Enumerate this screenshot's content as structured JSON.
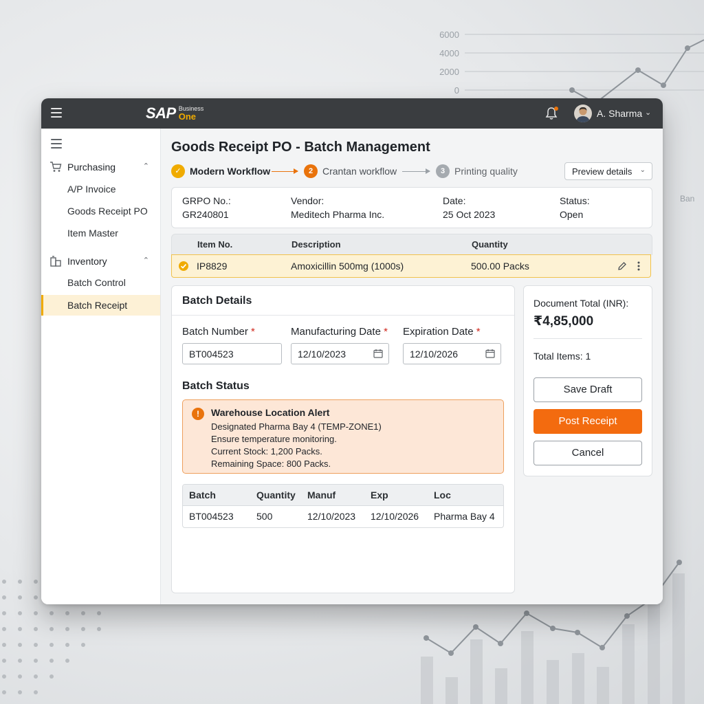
{
  "background": {
    "axis_ticks": [
      "6000",
      "4000",
      "2000",
      "0"
    ],
    "corner_text": "Ban"
  },
  "topbar": {
    "logo_main": "SAP",
    "logo_business": "Business",
    "logo_one": "One",
    "user_name": "A. Sharma",
    "icons": [
      "menu-icon",
      "bell-icon",
      "avatar",
      "chevron-down-icon"
    ]
  },
  "sidebar": {
    "groups": [
      {
        "label": "Purchasing",
        "icon": "cart-icon",
        "items": [
          "A/P Invoice",
          "Goods Receipt PO",
          "Item Master"
        ]
      },
      {
        "label": "Inventory",
        "icon": "inventory-icon",
        "items": [
          "Batch Control",
          "Batch Receipt"
        ]
      }
    ],
    "active_item": "Batch Receipt"
  },
  "page": {
    "title": "Goods Receipt PO - Batch Management",
    "steps": [
      {
        "number": "✓",
        "label": "Modern Workflow",
        "state": "done"
      },
      {
        "number": "2",
        "label": "Crantan workflow",
        "state": "current"
      },
      {
        "number": "3",
        "label": "Printing quality",
        "state": "pending"
      }
    ],
    "preview_button": "Preview details"
  },
  "header": {
    "grpo_label": "GRPO No.:",
    "grpo_value": "GR240801",
    "vendor_label": "Vendor:",
    "vendor_value": "Meditech Pharma Inc.",
    "date_label": "Date:",
    "date_value": "25 Oct 2023",
    "status_label": "Status:",
    "status_value": "Open"
  },
  "items_table": {
    "columns": [
      "Item No.",
      "Description",
      "Quantity"
    ],
    "rows": [
      {
        "item_no": "IP8829",
        "description": "Amoxicillin 500mg (1000s)",
        "quantity": "500.00 Packs"
      }
    ]
  },
  "batch_details": {
    "title": "Batch Details",
    "batch_number_label": "Batch Number",
    "batch_number_value": "BT004523",
    "mfg_label": "Manufacturing Date",
    "mfg_value": "12/10/2023",
    "exp_label": "Expiration Date",
    "exp_value": "12/10/2026",
    "required_mark": "*",
    "status_title": "Batch Status",
    "alert": {
      "title": "Warehouse Location Alert",
      "lines": [
        "Designated Pharma Bay 4 (TEMP-ZONE1)",
        "Ensure temperature monitoring.",
        "Current Stock: 1,200 Packs.",
        "Remaining Space: 800 Packs."
      ]
    },
    "table": {
      "columns": [
        "Batch",
        "Quantity",
        "Manuf",
        "Exp",
        "Loc"
      ],
      "row": [
        "BT004523",
        "500",
        "12/10/2023",
        "12/10/2026",
        "Pharma Bay 4"
      ]
    }
  },
  "summary": {
    "total_label": "Document Total (INR):",
    "total_value": "₹4,85,000",
    "items_label": "Total Items: 1",
    "save_draft": "Save Draft",
    "post_receipt": "Post Receipt",
    "cancel": "Cancel"
  },
  "colors": {
    "accent_orange": "#f36b0f",
    "highlight_yellow": "#fdf2d4",
    "topbar": "#3a3d40",
    "step_done": "#f0ab00"
  }
}
